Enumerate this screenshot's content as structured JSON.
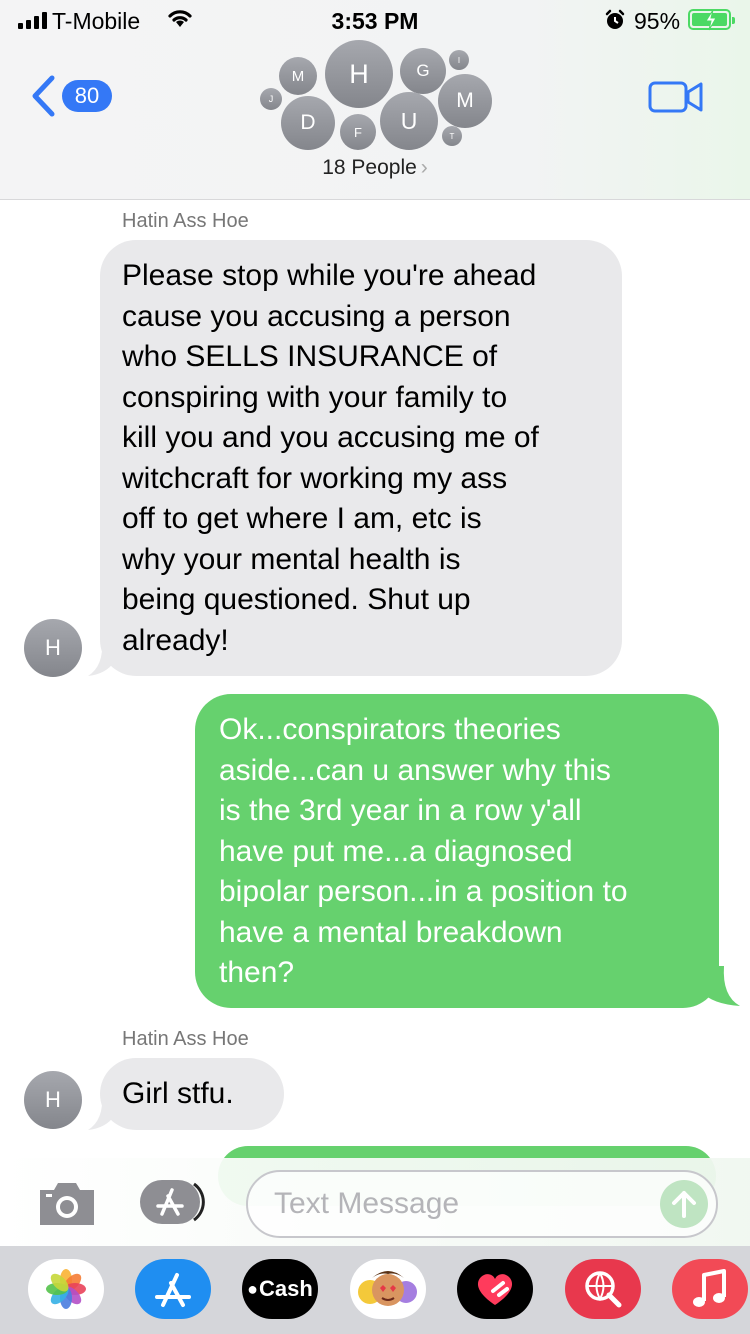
{
  "status_bar": {
    "carrier": "T-Mobile",
    "time": "3:53 PM",
    "battery_percent": "95%",
    "accent_color": "#4cd964"
  },
  "header": {
    "back_count": "80",
    "group_avatars": [
      "M",
      "H",
      "G",
      "I",
      "J",
      "M",
      "D",
      "U",
      "F",
      "T"
    ],
    "people_label": "18 People",
    "video_icon": "video-camera-icon",
    "accent_color": "#3478f6"
  },
  "messages": [
    {
      "direction": "received",
      "sender": "Hatin Ass Hoe",
      "avatar": "H",
      "lines": [
        "Please stop while you're ahead",
        "cause you accusing a person",
        "who SELLS INSURANCE of",
        "conspiring with your family to",
        "kill you and you accusing me of",
        "witchcraft for working my ass",
        "off to get where I am, etc is",
        "why your mental health is",
        "being questioned. Shut up",
        "already!"
      ]
    },
    {
      "direction": "sent",
      "lines": [
        "Ok...conspirators theories",
        "aside...can u answer why this",
        "is the 3rd year in a row y'all",
        "have put me...a diagnosed",
        "bipolar person...in a position to",
        "have a mental breakdown",
        "then?"
      ]
    },
    {
      "direction": "received",
      "sender": "Hatin Ass Hoe",
      "avatar": "H",
      "lines": [
        "Girl stfu."
      ]
    }
  ],
  "input_bar": {
    "placeholder": "Text Message",
    "camera_icon": "camera-icon",
    "apps_icon": "app-store-icon",
    "send_icon": "send-arrow-icon"
  },
  "app_tray": [
    {
      "name": "photos-app-icon",
      "label": ""
    },
    {
      "name": "app-store-app-icon",
      "label": ""
    },
    {
      "name": "apple-cash-app-icon",
      "label": "Cash"
    },
    {
      "name": "memoji-app-icon",
      "label": ""
    },
    {
      "name": "digital-touch-app-icon",
      "label": ""
    },
    {
      "name": "images-search-app-icon",
      "label": ""
    },
    {
      "name": "music-app-icon",
      "label": ""
    }
  ],
  "colors": {
    "sent_bubble": "#66d16e",
    "received_bubble": "#e9e9eb"
  }
}
